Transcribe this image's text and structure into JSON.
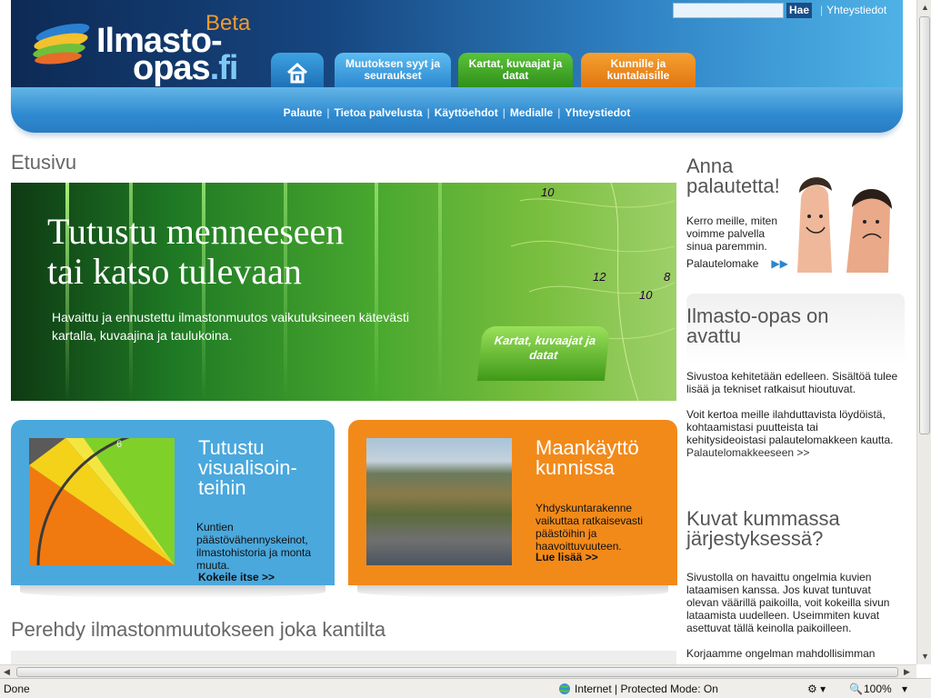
{
  "header": {
    "logo_line1": "Ilmasto-",
    "logo_line2": "opas",
    "logo_tld": ".fi",
    "beta": "Beta",
    "search_button": "Hae",
    "top_contact": "Yhteystiedot",
    "tabs": [
      {
        "label": "",
        "icon": "home-icon"
      },
      {
        "label": "Muutoksen syyt ja seuraukset"
      },
      {
        "label": "Kartat, kuvaajat ja datat"
      },
      {
        "label": "Kunnille ja kuntalaisille"
      }
    ],
    "subnav": [
      "Palaute",
      "Tietoa palvelusta",
      "Käyttöehdot",
      "Medialle",
      "Yhteystiedot"
    ]
  },
  "main": {
    "page_title": "Etusivu",
    "hero": {
      "title_line1": "Tutustu menneeseen",
      "title_line2": "tai katso tulevaan",
      "text": "Havaittu ja ennustettu ilmastonmuutos vaikutuksineen kätevästi kartalla, kuvaajina ja taulukoina.",
      "button": "Kartat, kuvaajat ja datat",
      "map_numbers": [
        "10",
        "12",
        "8",
        "10"
      ]
    },
    "card_vis": {
      "title": "Tutustu visualisoin- teihin",
      "text": "Kuntien päästövähennyskeinot, ilmastohistoria ja monta muuta.",
      "more": "Kokeile itse >>",
      "gauge_number": "6"
    },
    "card_land": {
      "title": "Maankäyttö kunnissa",
      "text": "Yhdyskuntarakenne vaikuttaa ratkaisevasti päästöihin ja haavoittuvuuteen.",
      "more": "Lue lisää >>"
    },
    "section_title": "Perehdy ilmastonmuutokseen joka kantilta"
  },
  "sidebar": {
    "feedback": {
      "title": "Anna palautetta!",
      "text": "Kerro meille, miten voimme palvella sinua paremmin.",
      "link": "Palautelomake"
    },
    "opened": {
      "title": "Ilmasto-opas on avattu",
      "p1": "Sivustoa kehitetään edelleen. Sisältöä tulee lisää ja tekniset ratkaisut hioutuvat.",
      "p2": "Voit kertoa meille ilahduttavista löydöistä, kohtaamistasi puutteista tai kehitysideoistasi palautelomakkeen kautta.",
      "p2_link": "Palautelomakkeeseen >>"
    },
    "images": {
      "title": "Kuvat kummassa järjestyksessä?",
      "p1": "Sivustolla on havaittu ongelmia kuvien lataamisen kanssa. Jos kuvat tuntuvat olevan väärillä paikoilla, voit kokeilla sivun lataamista uudelleen. Useimmiten kuvat asettuvat tällä keinolla paikoilleen.",
      "p2": "Korjaamme ongelman mahdollisimman"
    }
  },
  "statusbar": {
    "status": "Done",
    "zone": "Internet | Protected Mode: On",
    "zoom": "100%"
  },
  "colors": {
    "header_dark": "#16457f",
    "tab_blue": "#2a86cf",
    "tab_green": "#2e8e18",
    "tab_orange": "#e07410",
    "hero_green": "#49a82f",
    "card_blue": "#4aa8dd",
    "card_orange": "#f28a1a"
  }
}
